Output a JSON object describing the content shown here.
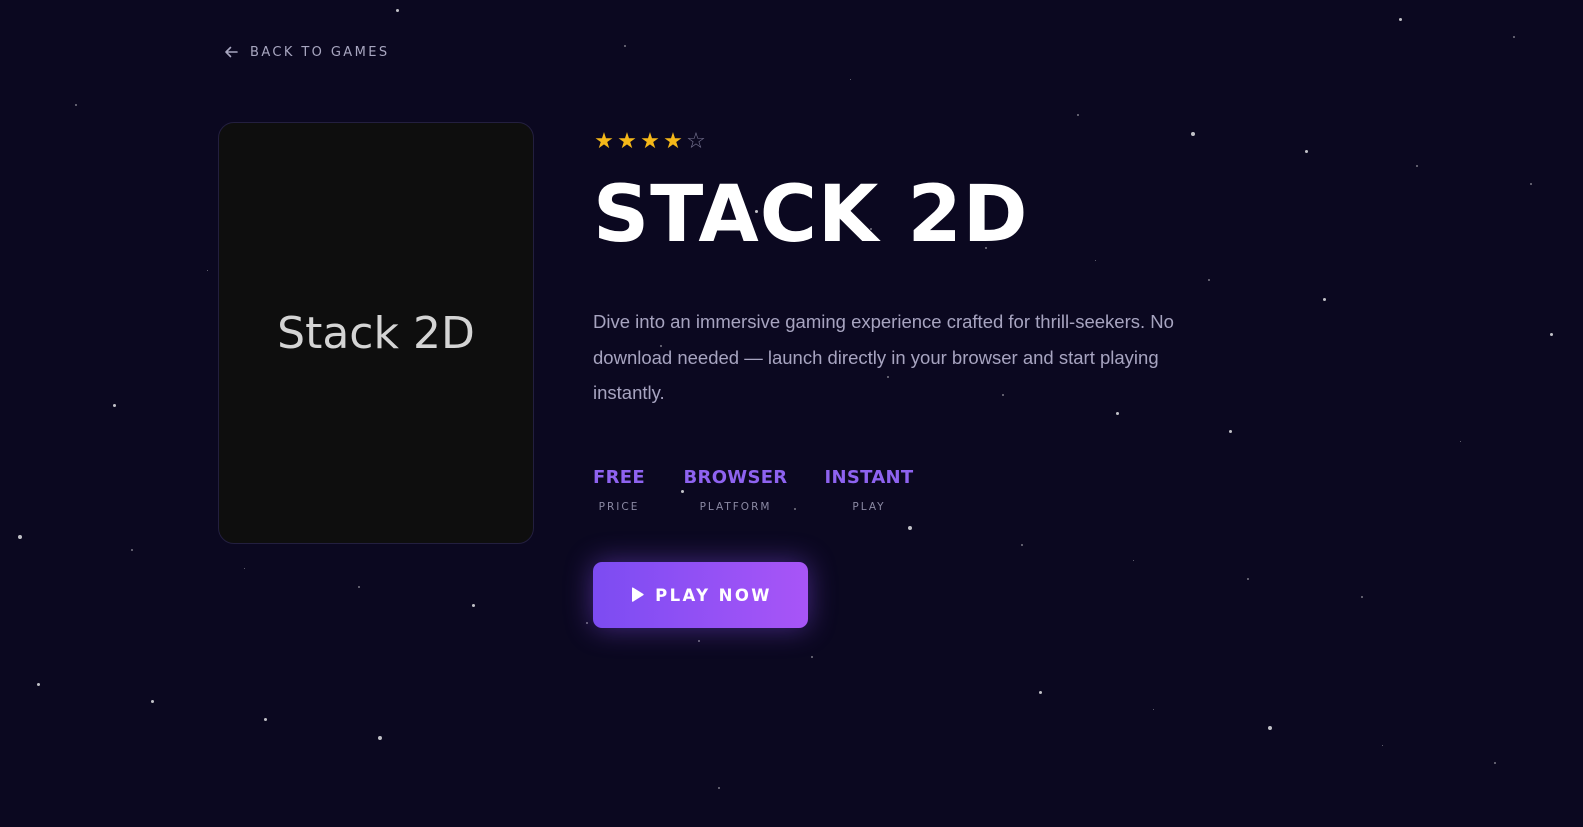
{
  "nav": {
    "back_label": "BACK TO GAMES",
    "back_icon": "arrow-left-icon"
  },
  "cover": {
    "title": "Stack 2D"
  },
  "game": {
    "rating": 4,
    "rating_max": 5,
    "title": "STACK 2D",
    "description": "Dive into an immersive gaming experience crafted for thrill-seekers. No download needed — launch directly in your browser and start playing instantly.",
    "stats": [
      {
        "value": "FREE",
        "label": "PRICE"
      },
      {
        "value": "BROWSER",
        "label": "PLATFORM"
      },
      {
        "value": "INSTANT",
        "label": "PLAY"
      }
    ]
  },
  "actions": {
    "play_label": "PLAY NOW",
    "play_icon": "play-icon"
  },
  "colors": {
    "background": "#0b0820",
    "accent": "#8e63f0",
    "button_gradient_start": "#7c4cf2",
    "button_gradient_end": "#a855f7",
    "star_filled": "#f5b819",
    "star_empty": "#7b7896",
    "text_muted": "#a7a4c0"
  }
}
